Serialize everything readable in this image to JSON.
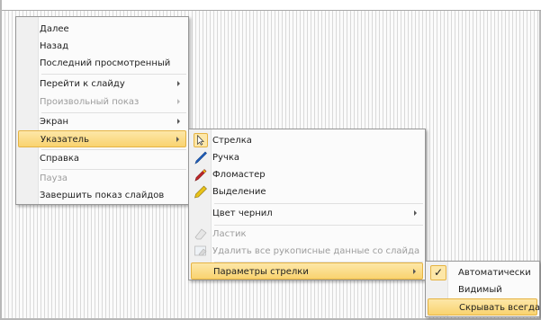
{
  "main_menu": {
    "items": [
      {
        "label": "Далее"
      },
      {
        "label": "Назад"
      },
      {
        "label": "Последний просмотренный"
      },
      {
        "label": "Перейти к слайду"
      },
      {
        "label": "Произвольный показ"
      },
      {
        "label": "Экран"
      },
      {
        "label": "Указатель"
      },
      {
        "label": "Справка"
      },
      {
        "label": "Пауза"
      },
      {
        "label": "Завершить показ слайдов"
      }
    ]
  },
  "pointer_menu": {
    "items": [
      {
        "label": "Стрелка",
        "icon": "arrow-pointer-icon"
      },
      {
        "label": "Ручка",
        "icon": "pen-icon"
      },
      {
        "label": "Фломастер",
        "icon": "felt-tip-icon"
      },
      {
        "label": "Выделение",
        "icon": "highlighter-icon"
      },
      {
        "label": "Цвет чернил"
      },
      {
        "label": "Ластик",
        "icon": "eraser-icon"
      },
      {
        "label": "Удалить все рукописные данные со слайда",
        "icon": "erase-all-icon"
      },
      {
        "label": "Параметры стрелки"
      }
    ]
  },
  "arrow_options_menu": {
    "items": [
      {
        "label": "Автоматически",
        "check": "✓"
      },
      {
        "label": "Видимый"
      },
      {
        "label": "Скрывать всегда"
      }
    ]
  },
  "colors": {
    "highlight": "#f9d36f",
    "highlight_border": "#e5b343",
    "pen": "#1f5fbf",
    "felt": "#c0282a",
    "marker": "#e8c21a"
  }
}
